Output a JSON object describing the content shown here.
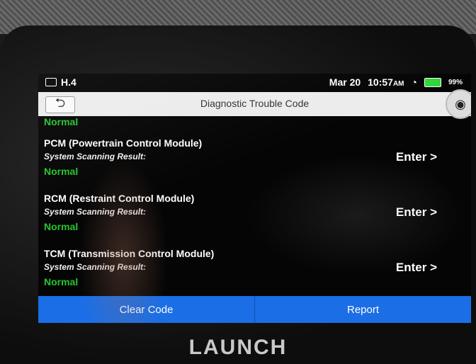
{
  "statusbar": {
    "left_text": "H.4",
    "date": "Mar 20",
    "time": "10:57",
    "ampm": "AM",
    "battery": "99%"
  },
  "titlebar": {
    "back_icon": "back-arrow-icon",
    "title": "Diagnostic Trouble Code",
    "camera_icon": "camera-icon"
  },
  "first_status": "Normal",
  "modules": [
    {
      "name": "PCM (Powertrain Control Module)",
      "sub": "System Scanning Result:",
      "status": "Normal",
      "enter": "Enter >"
    },
    {
      "name": "RCM (Restraint Control Module)",
      "sub": "System Scanning Result:",
      "status": "Normal",
      "enter": "Enter >"
    },
    {
      "name": "TCM (Transmission Control Module)",
      "sub": "System Scanning Result:",
      "status": "Normal",
      "enter": "Enter >"
    }
  ],
  "buttons": {
    "clear": "Clear Code",
    "report": "Report"
  },
  "brand": "LAUNCH",
  "colors": {
    "normal": "#25c52e",
    "button": "#1b6ee6",
    "battery": "#2fd63a"
  }
}
